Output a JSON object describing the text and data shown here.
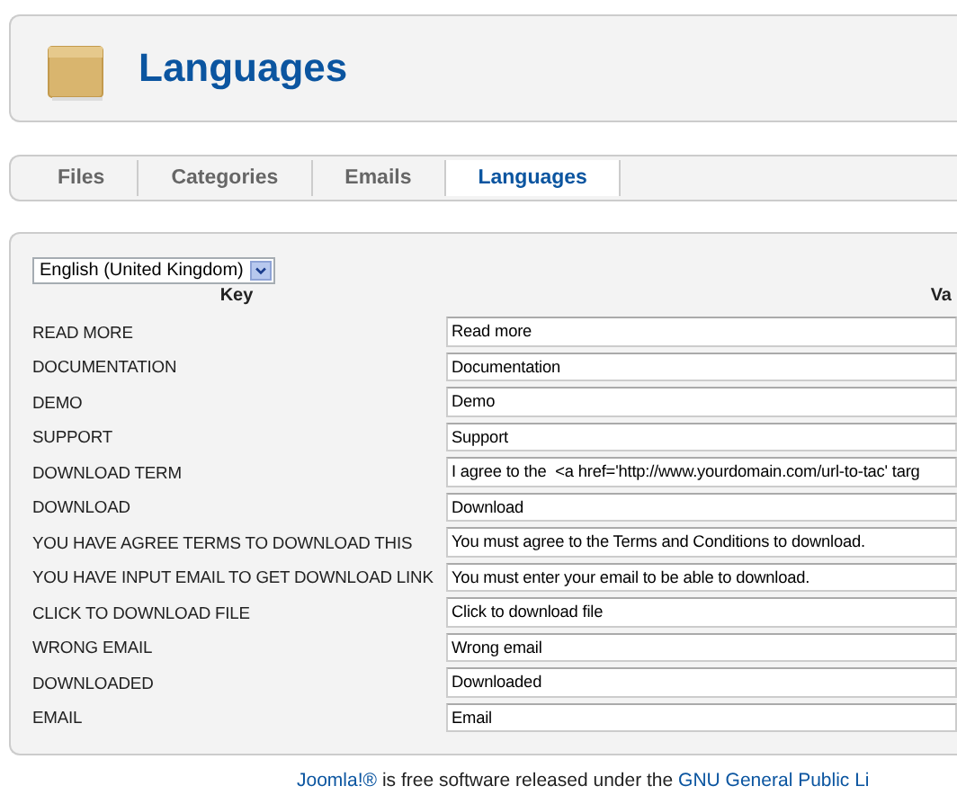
{
  "header": {
    "title": "Languages"
  },
  "tabs": [
    {
      "label": "Files",
      "selected": false
    },
    {
      "label": "Categories",
      "selected": false
    },
    {
      "label": "Emails",
      "selected": false
    },
    {
      "label": "Languages",
      "selected": true
    }
  ],
  "language_select": {
    "value": "English (United Kingdom)"
  },
  "table": {
    "columns": [
      "Key",
      "Va"
    ],
    "rows": [
      {
        "key": "READ MORE",
        "value": "Read more"
      },
      {
        "key": "DOCUMENTATION",
        "value": "Documentation"
      },
      {
        "key": "DEMO",
        "value": "Demo"
      },
      {
        "key": "SUPPORT",
        "value": "Support"
      },
      {
        "key": "DOWNLOAD TERM",
        "value": "I agree to the  <a href='http://www.yourdomain.com/url-to-tac' targ"
      },
      {
        "key": "DOWNLOAD",
        "value": "Download"
      },
      {
        "key": "YOU HAVE AGREE TERMS TO DOWNLOAD THIS",
        "value": "You must agree to the Terms and Conditions to download."
      },
      {
        "key": "YOU HAVE INPUT EMAIL TO GET DOWNLOAD LINK",
        "value": "You must enter your email to be able to download."
      },
      {
        "key": "CLICK TO DOWNLOAD FILE",
        "value": "Click to download file"
      },
      {
        "key": "WRONG EMAIL",
        "value": "Wrong email"
      },
      {
        "key": "DOWNLOADED",
        "value": "Downloaded"
      },
      {
        "key": "EMAIL",
        "value": "Email"
      }
    ]
  },
  "footer": {
    "link_1": "Joomla!®",
    "text": "is free software released under the",
    "link_2": "GNU General Public Li"
  }
}
